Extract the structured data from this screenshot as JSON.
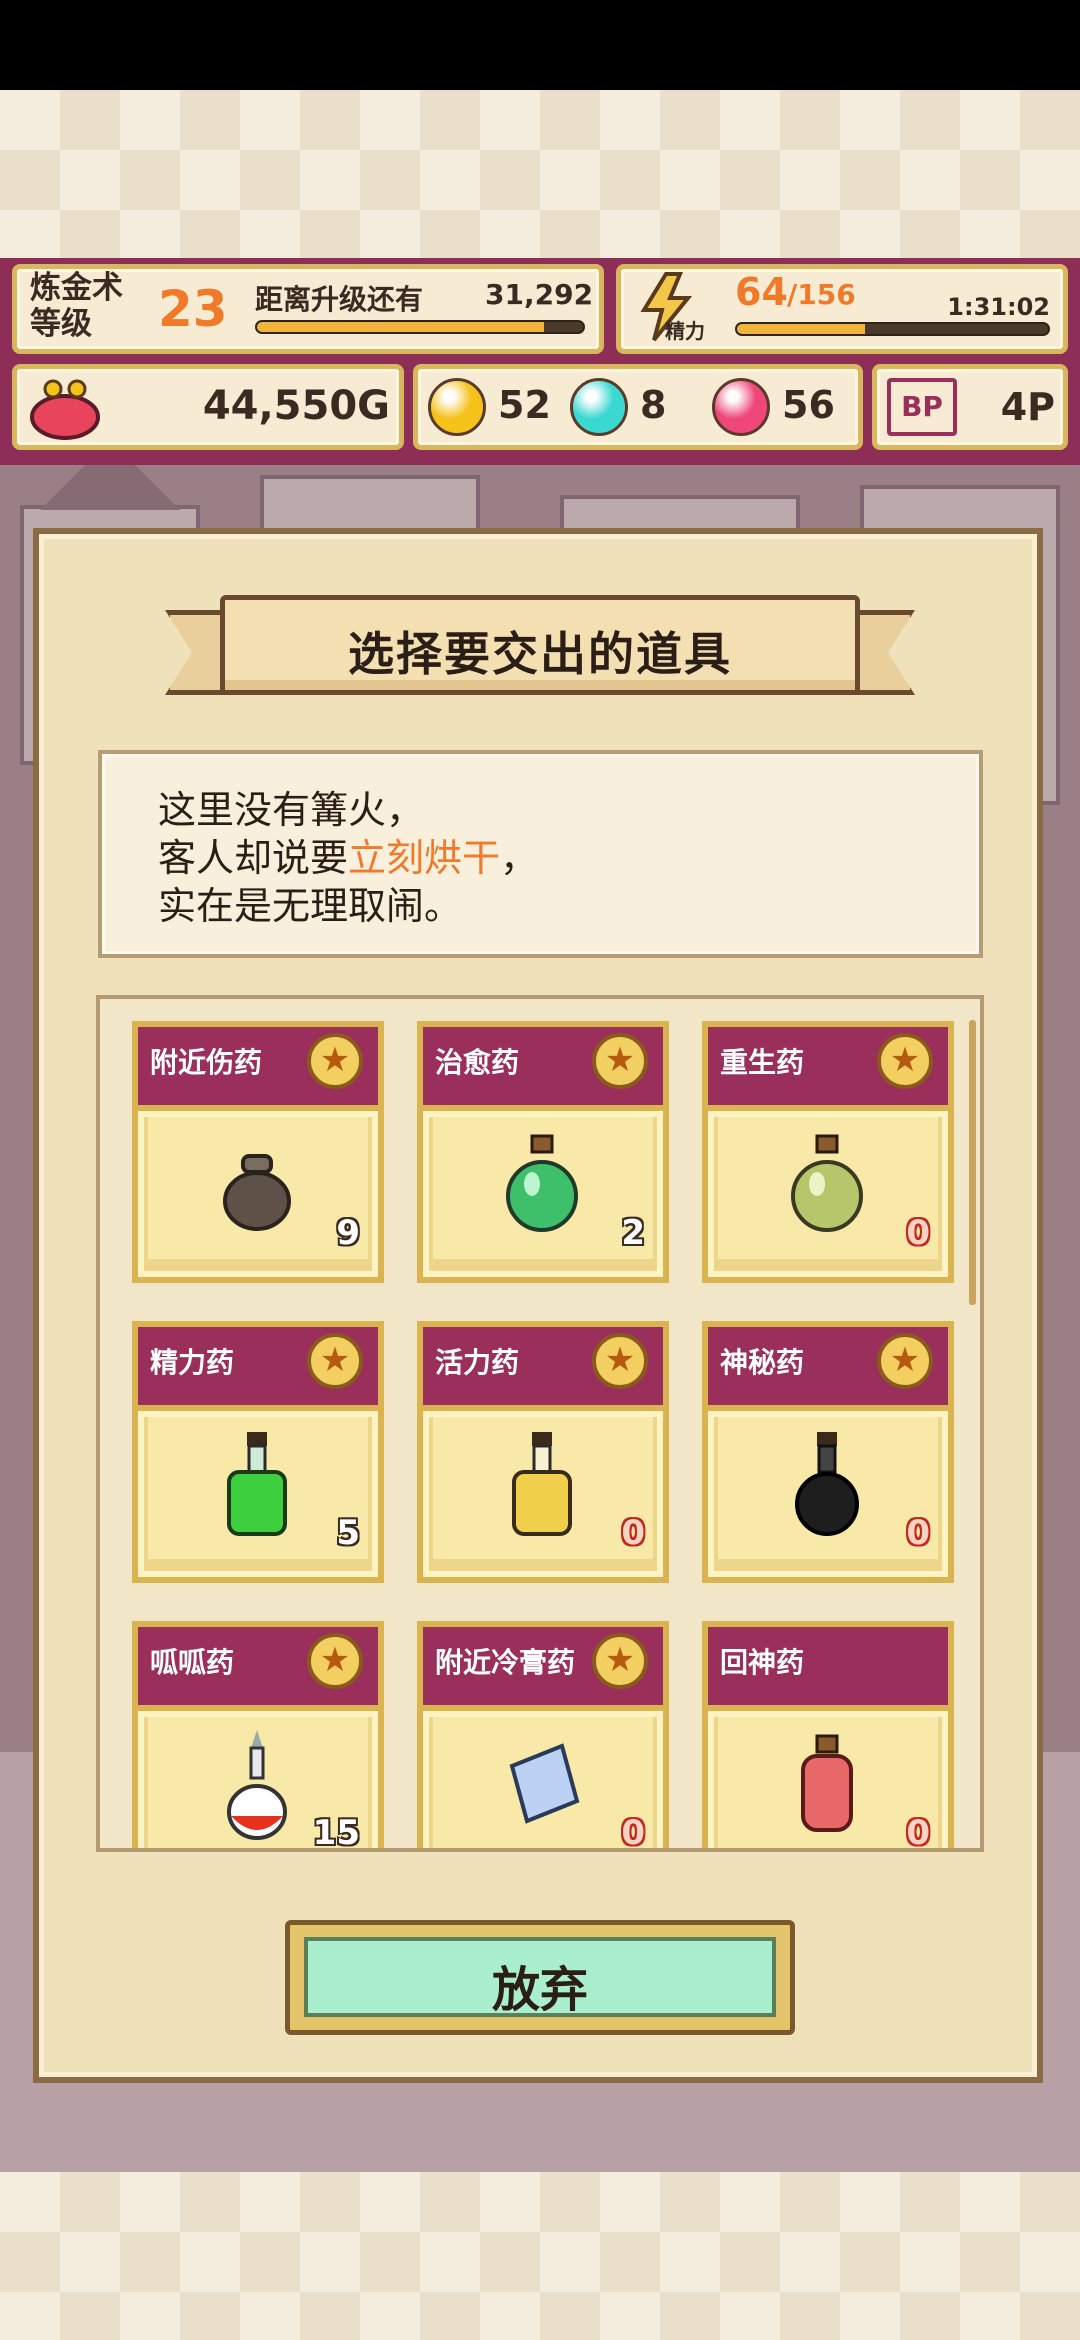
{
  "hud": {
    "level_label": "炼金术\n等级",
    "level": "23",
    "next_label": "距离升级还有",
    "next_value": "31,292",
    "next_progress": 0.88,
    "energy_label": "精力",
    "energy_current": "64",
    "energy_max": "/156",
    "energy_progress": 0.41,
    "timer": "1:31:02",
    "gold": "44,550G",
    "gems": [
      {
        "name": "yellow-orb",
        "color": "#f5c21a",
        "value": "52"
      },
      {
        "name": "cyan-orb",
        "color": "#3ad9d0",
        "value": "8"
      },
      {
        "name": "pink-orb",
        "color": "#f0477a",
        "value": "56"
      }
    ],
    "bp_badge": "BP",
    "bp_value": "4P"
  },
  "dialog": {
    "title": "选择要交出的道具",
    "message_line1": "这里没有篝火，",
    "message_line2_pre": "客人却说要",
    "message_line2_hl": "立刻烘干",
    "message_line2_post": "，",
    "message_line3": "实在是无理取闹。",
    "items": [
      {
        "name": "附近伤药",
        "count": "9",
        "starred": true,
        "icon": "pouch-icon"
      },
      {
        "name": "治愈药",
        "count": "2",
        "starred": true,
        "icon": "green-potion-icon"
      },
      {
        "name": "重生药",
        "count": "0",
        "starred": true,
        "icon": "olive-potion-icon"
      },
      {
        "name": "精力药",
        "count": "5",
        "starred": true,
        "icon": "lime-flask-icon"
      },
      {
        "name": "活力药",
        "count": "0",
        "starred": true,
        "icon": "yellow-flask-icon"
      },
      {
        "name": "神秘药",
        "count": "0",
        "starred": true,
        "icon": "black-flask-icon"
      },
      {
        "name": "呱呱药",
        "count": "15",
        "starred": true,
        "icon": "red-vial-icon"
      },
      {
        "name": "附近冷膏药",
        "count": "0",
        "starred": true,
        "icon": "cloth-icon"
      },
      {
        "name": "回神药",
        "count": "0",
        "starred": false,
        "icon": "pink-potion-icon"
      }
    ],
    "abandon_label": "放弃"
  },
  "colors": {
    "hud_bg": "#8c2e55",
    "accent_orange": "#f07a2a",
    "card_header": "#9a2f5c",
    "abandon_button": "#a9efce"
  }
}
